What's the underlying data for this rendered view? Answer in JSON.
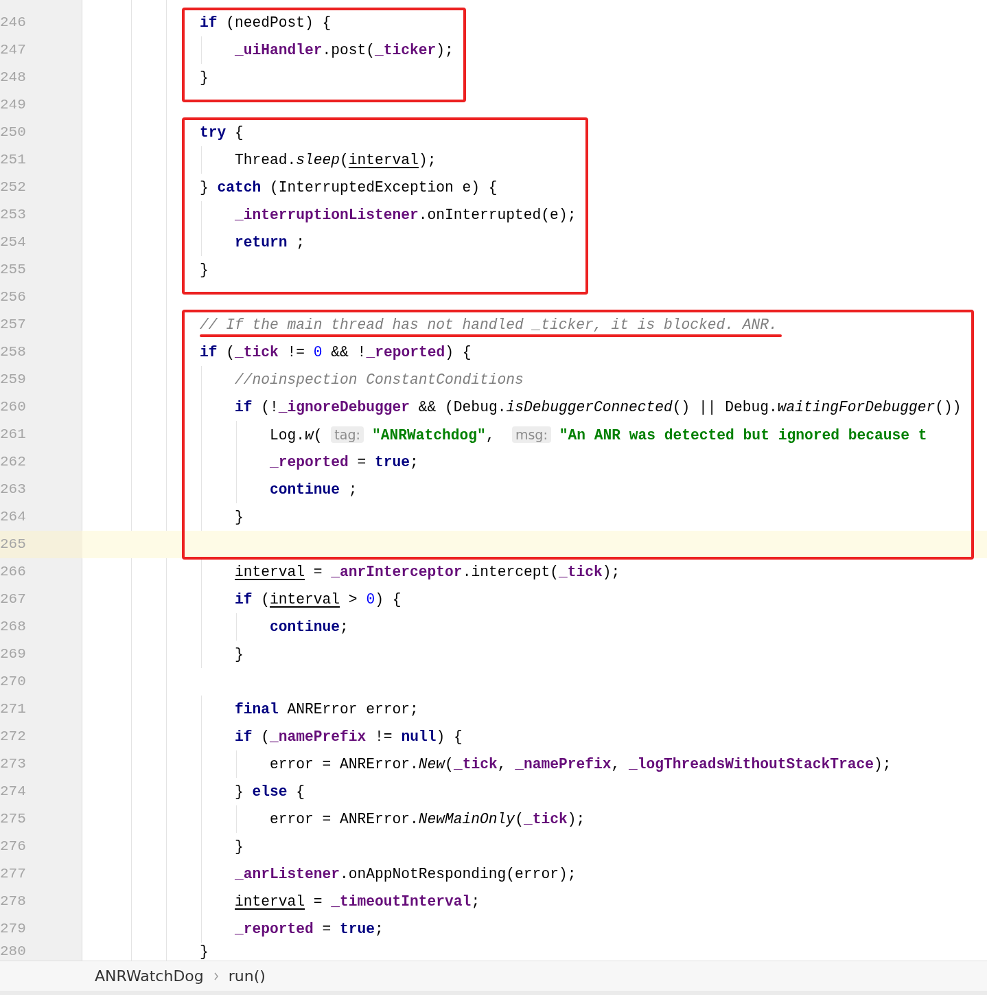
{
  "editor": {
    "sections": [
      {
        "boxed": true,
        "lines": [
          {
            "number": "246",
            "current": false,
            "underlined": false,
            "code": [
              {
                "kind": "keyword",
                "text": "            if"
              },
              {
                "kind": "plain",
                "text": " (needPost) {"
              }
            ]
          },
          {
            "number": "247",
            "current": false,
            "underlined": false,
            "code": [
              {
                "kind": "field",
                "text": "                _uiHandler"
              },
              {
                "kind": "plain",
                "text": ".post("
              },
              {
                "kind": "field",
                "text": "_ticker"
              },
              {
                "kind": "plain",
                "text": ");"
              }
            ]
          },
          {
            "number": "248",
            "current": false,
            "underlined": false,
            "code": [
              {
                "kind": "plain",
                "text": "            }"
              }
            ]
          }
        ]
      },
      {
        "boxed": false,
        "lines": [
          {
            "number": "249",
            "current": false
          }
        ]
      },
      {
        "boxed": true,
        "lines": [
          {
            "number": "250",
            "current": false,
            "underlined": false,
            "code": [
              {
                "kind": "keyword",
                "text": "            try"
              },
              {
                "kind": "plain",
                "text": " {"
              }
            ]
          },
          {
            "number": "251",
            "current": false,
            "underlined": false,
            "code": [
              {
                "kind": "plain",
                "text": "                Thread."
              },
              {
                "kind": "static",
                "text": "sleep"
              },
              {
                "kind": "plain",
                "text": "("
              },
              {
                "kind": "var",
                "text": "interval"
              },
              {
                "kind": "plain",
                "text": ");"
              }
            ]
          },
          {
            "number": "252",
            "current": false,
            "underlined": false,
            "code": [
              {
                "kind": "plain",
                "text": "            } "
              },
              {
                "kind": "keyword",
                "text": "catch"
              },
              {
                "kind": "plain",
                "text": " (InterruptedException e) {"
              }
            ]
          },
          {
            "number": "253",
            "current": false,
            "underlined": false,
            "code": [
              {
                "kind": "field",
                "text": "                _interruptionListener"
              },
              {
                "kind": "plain",
                "text": ".onInterrupted(e);"
              }
            ]
          },
          {
            "number": "254",
            "current": false,
            "underlined": false,
            "code": [
              {
                "kind": "keyword",
                "text": "                return"
              },
              {
                "kind": "plain",
                "text": " ;"
              }
            ]
          },
          {
            "number": "255",
            "current": false,
            "underlined": false,
            "code": [
              {
                "kind": "plain",
                "text": "            }"
              }
            ]
          }
        ]
      },
      {
        "boxed": false,
        "lines": [
          {
            "number": "256",
            "current": false
          }
        ]
      },
      {
        "boxed": true,
        "lines": [
          {
            "number": "257",
            "current": false,
            "underlined": true,
            "code": [
              {
                "kind": "comment",
                "text": "            // If the main thread has not handled _ticker, it is blocked. ANR."
              }
            ]
          },
          {
            "number": "258",
            "current": false,
            "underlined": false,
            "code": [
              {
                "kind": "keyword",
                "text": "            if"
              },
              {
                "kind": "plain",
                "text": " ("
              },
              {
                "kind": "field",
                "text": "_tick"
              },
              {
                "kind": "plain",
                "text": " != "
              },
              {
                "kind": "number",
                "text": "0"
              },
              {
                "kind": "plain",
                "text": " && !"
              },
              {
                "kind": "field",
                "text": "_reported"
              },
              {
                "kind": "plain",
                "text": ") {"
              }
            ]
          },
          {
            "number": "259",
            "current": false,
            "underlined": false,
            "code": [
              {
                "kind": "comment",
                "text": "                //noinspection ConstantConditions"
              }
            ]
          },
          {
            "number": "260",
            "current": false,
            "underlined": false,
            "code": [
              {
                "kind": "keyword",
                "text": "                if"
              },
              {
                "kind": "plain",
                "text": " (!"
              },
              {
                "kind": "field",
                "text": "_ignoreDebugger"
              },
              {
                "kind": "plain",
                "text": " && (Debug."
              },
              {
                "kind": "static",
                "text": "isDebuggerConnected"
              },
              {
                "kind": "plain",
                "text": "() || Debug."
              },
              {
                "kind": "static",
                "text": "waitingForDebugger"
              },
              {
                "kind": "plain",
                "text": "())"
              }
            ]
          },
          {
            "number": "261",
            "current": false,
            "underlined": false,
            "code": [
              {
                "kind": "plain",
                "text": "                    Log."
              },
              {
                "kind": "static",
                "text": "w"
              },
              {
                "kind": "plain",
                "text": "( "
              },
              {
                "kind": "hint",
                "text": "tag:"
              },
              {
                "kind": "string",
                "text": "\"ANRWatchdog\""
              },
              {
                "kind": "plain",
                "text": ",  "
              },
              {
                "kind": "hint",
                "text": "msg:"
              },
              {
                "kind": "string",
                "text": "\"An ANR was detected but ignored because t"
              }
            ]
          },
          {
            "number": "262",
            "current": false,
            "underlined": false,
            "code": [
              {
                "kind": "field",
                "text": "                    _reported"
              },
              {
                "kind": "plain",
                "text": " = "
              },
              {
                "kind": "keyword",
                "text": "true"
              },
              {
                "kind": "plain",
                "text": ";"
              }
            ]
          },
          {
            "number": "263",
            "current": false,
            "underlined": false,
            "code": [
              {
                "kind": "keyword",
                "text": "                    continue"
              },
              {
                "kind": "plain",
                "text": " ;"
              }
            ]
          },
          {
            "number": "264",
            "current": false,
            "underlined": false,
            "code": [
              {
                "kind": "plain",
                "text": "                }"
              }
            ]
          },
          {
            "number": "265",
            "current": true
          }
        ]
      },
      {
        "boxed": false,
        "lines": [
          {
            "number": "266",
            "current": false,
            "underlined": false,
            "code": [
              {
                "kind": "var",
                "text": "                interval"
              },
              {
                "kind": "plain",
                "text": " = "
              },
              {
                "kind": "field",
                "text": "_anrInterceptor"
              },
              {
                "kind": "plain",
                "text": ".intercept("
              },
              {
                "kind": "field",
                "text": "_tick"
              },
              {
                "kind": "plain",
                "text": ");"
              }
            ]
          },
          {
            "number": "267",
            "current": false,
            "underlined": false,
            "code": [
              {
                "kind": "keyword",
                "text": "                if"
              },
              {
                "kind": "plain",
                "text": " ("
              },
              {
                "kind": "var",
                "text": "interval"
              },
              {
                "kind": "plain",
                "text": " > "
              },
              {
                "kind": "number",
                "text": "0"
              },
              {
                "kind": "plain",
                "text": ") {"
              }
            ]
          },
          {
            "number": "268",
            "current": false,
            "underlined": false,
            "code": [
              {
                "kind": "keyword",
                "text": "                    continue"
              },
              {
                "kind": "plain",
                "text": ";"
              }
            ]
          },
          {
            "number": "269",
            "current": false,
            "underlined": false,
            "code": [
              {
                "kind": "plain",
                "text": "                }"
              }
            ]
          },
          {
            "number": "270",
            "current": false
          },
          {
            "number": "271",
            "current": false,
            "underlined": false,
            "code": [
              {
                "kind": "keyword",
                "text": "                final"
              },
              {
                "kind": "plain",
                "text": " ANRError error;"
              }
            ]
          },
          {
            "number": "272",
            "current": false,
            "underlined": false,
            "code": [
              {
                "kind": "keyword",
                "text": "                if"
              },
              {
                "kind": "plain",
                "text": " ("
              },
              {
                "kind": "field",
                "text": "_namePrefix"
              },
              {
                "kind": "plain",
                "text": " != "
              },
              {
                "kind": "keyword",
                "text": "null"
              },
              {
                "kind": "plain",
                "text": ") {"
              }
            ]
          },
          {
            "number": "273",
            "current": false,
            "underlined": false,
            "code": [
              {
                "kind": "plain",
                "text": "                    error = ANRError."
              },
              {
                "kind": "static",
                "text": "New"
              },
              {
                "kind": "plain",
                "text": "("
              },
              {
                "kind": "field",
                "text": "_tick"
              },
              {
                "kind": "plain",
                "text": ", "
              },
              {
                "kind": "field",
                "text": "_namePrefix"
              },
              {
                "kind": "plain",
                "text": ", "
              },
              {
                "kind": "field",
                "text": "_logThreadsWithoutStackTrace"
              },
              {
                "kind": "plain",
                "text": ");"
              }
            ]
          },
          {
            "number": "274",
            "current": false,
            "underlined": false,
            "code": [
              {
                "kind": "plain",
                "text": "                } "
              },
              {
                "kind": "keyword",
                "text": "else"
              },
              {
                "kind": "plain",
                "text": " {"
              }
            ]
          },
          {
            "number": "275",
            "current": false,
            "underlined": false,
            "code": [
              {
                "kind": "plain",
                "text": "                    error = ANRError."
              },
              {
                "kind": "static",
                "text": "NewMainOnly"
              },
              {
                "kind": "plain",
                "text": "("
              },
              {
                "kind": "field",
                "text": "_tick"
              },
              {
                "kind": "plain",
                "text": ");"
              }
            ]
          },
          {
            "number": "276",
            "current": false,
            "underlined": false,
            "code": [
              {
                "kind": "plain",
                "text": "                }"
              }
            ]
          },
          {
            "number": "277",
            "current": false,
            "underlined": false,
            "code": [
              {
                "kind": "field",
                "text": "                _anrListener"
              },
              {
                "kind": "plain",
                "text": ".onAppNotResponding(error);"
              }
            ]
          },
          {
            "number": "278",
            "current": false,
            "underlined": false,
            "code": [
              {
                "kind": "var",
                "text": "                interval"
              },
              {
                "kind": "plain",
                "text": " = "
              },
              {
                "kind": "field",
                "text": "_timeoutInterval"
              },
              {
                "kind": "plain",
                "text": ";"
              }
            ]
          },
          {
            "number": "279",
            "current": false,
            "underlined": false,
            "code": [
              {
                "kind": "field",
                "text": "                _reported"
              },
              {
                "kind": "plain",
                "text": " = "
              },
              {
                "kind": "keyword",
                "text": "true"
              },
              {
                "kind": "plain",
                "text": ";"
              }
            ]
          },
          {
            "number": "280",
            "current": false,
            "underlined": false,
            "code": [
              {
                "kind": "plain",
                "text": "            }"
              }
            ]
          }
        ]
      }
    ]
  },
  "breadcrumbs": [
    {
      "label": "ANRWatchDog"
    },
    {
      "label": "run()"
    }
  ]
}
